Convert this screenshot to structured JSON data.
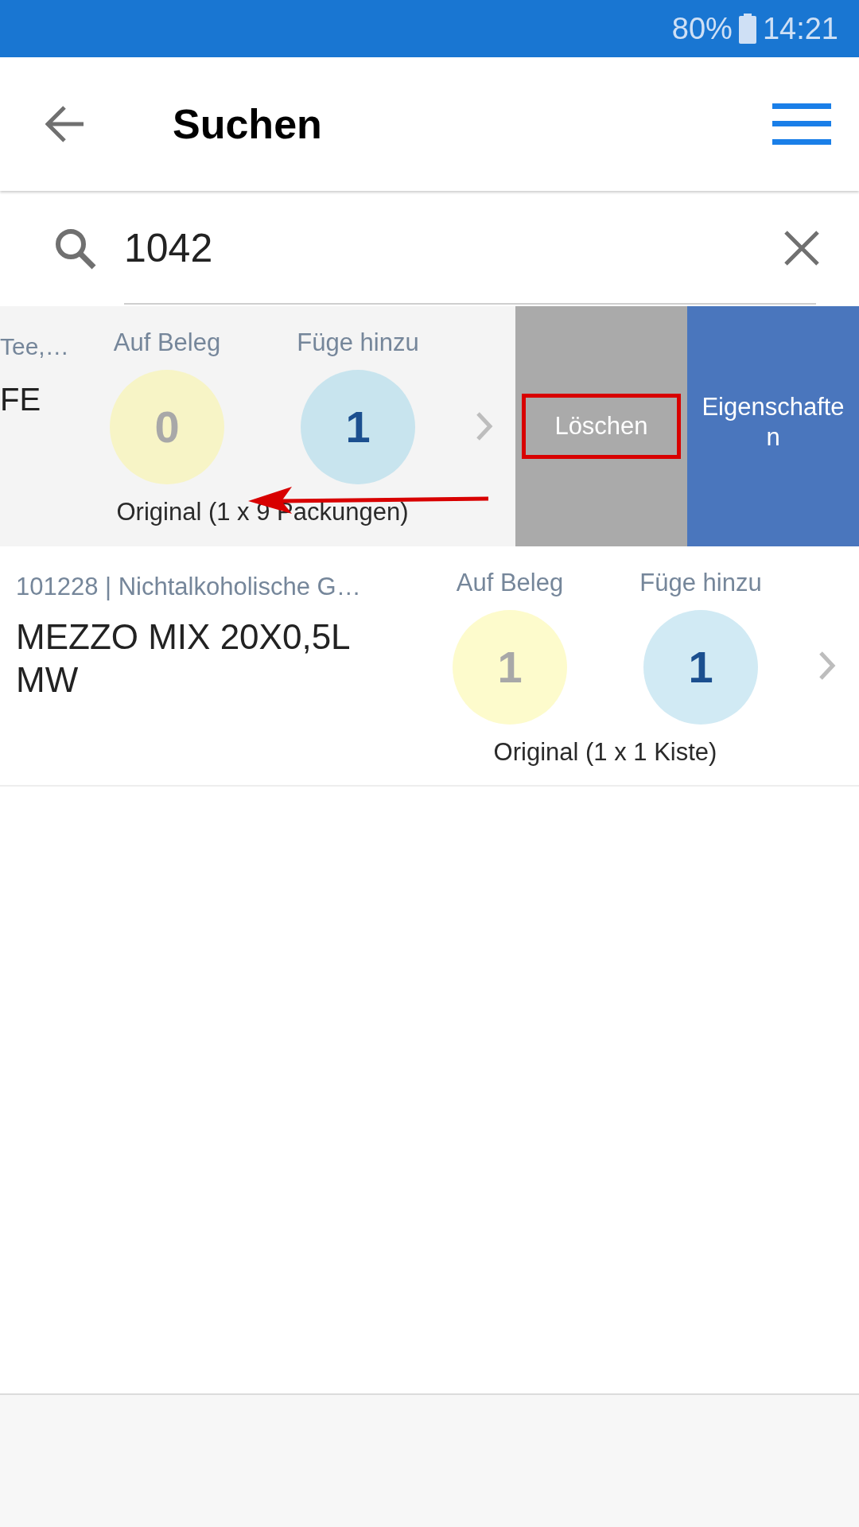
{
  "status_bar": {
    "battery": "80%",
    "time": "14:21"
  },
  "header": {
    "title": "Suchen"
  },
  "search": {
    "value": "1042"
  },
  "results": [
    {
      "kind": "swiped",
      "meta": "Tee,…",
      "name": "FE",
      "on_receipt_label": "Auf Beleg",
      "on_receipt": "0",
      "add_label": "Füge hinzu",
      "add": "1",
      "caption": "Original (1 x 9 Packungen)",
      "actions": [
        {
          "kind": "delete",
          "label": "Löschen",
          "highlighted": true
        },
        {
          "kind": "properties",
          "label": "Eigenschaften"
        }
      ]
    },
    {
      "kind": "normal",
      "meta": "101228 | Nichtalkoholische G…",
      "name": "MEZZO MIX 20X0,5L MW",
      "on_receipt_label": "Auf Beleg",
      "on_receipt": "1",
      "add_label": "Füge hinzu",
      "add": "1",
      "caption": "Original (1 x 1 Kiste)"
    }
  ]
}
